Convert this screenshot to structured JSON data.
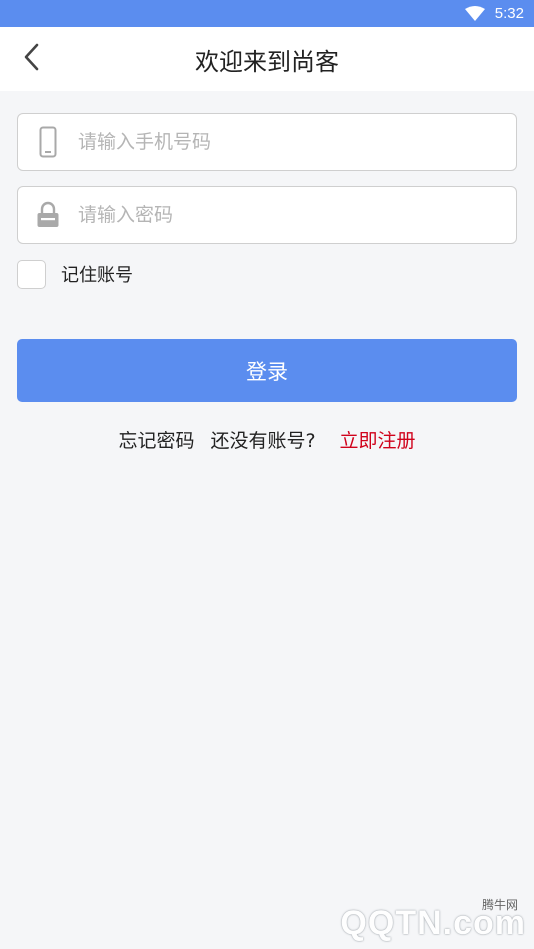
{
  "status_bar": {
    "time": "5:32",
    "wifi_icon": "wifi-icon"
  },
  "header": {
    "title": "欢迎来到尚客",
    "back_icon": "chevron-left-icon"
  },
  "form": {
    "phone": {
      "placeholder": "请输入手机号码",
      "value": "",
      "icon": "phone-icon"
    },
    "password": {
      "placeholder": "请输入密码",
      "value": "",
      "icon": "lock-icon"
    },
    "remember": {
      "label": "记住账号",
      "checked": false
    },
    "login_label": "登录"
  },
  "links": {
    "forgot": "忘记密码",
    "no_account": "还没有账号?",
    "register": "立即注册"
  },
  "watermark": {
    "text": "QQTN.com",
    "small": "腾牛网"
  },
  "colors": {
    "accent": "#5b8def",
    "register": "#d0021b",
    "background": "#f5f6f8"
  }
}
